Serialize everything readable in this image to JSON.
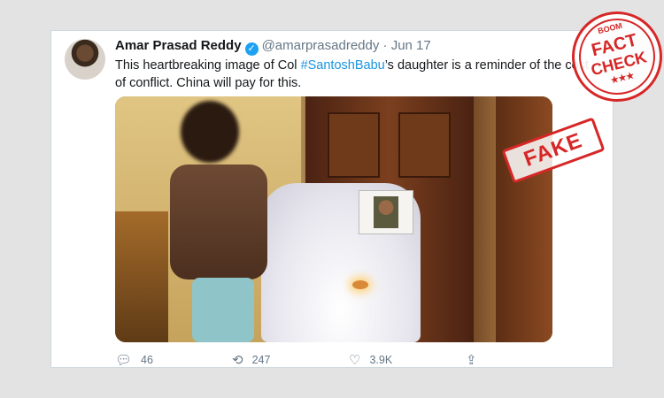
{
  "tweet": {
    "author_name": "Amar Prasad Reddy",
    "verified_glyph": "✓",
    "handle": "@amarprasadreddy",
    "separator": "·",
    "date": "Jun 17",
    "text_before": "This heartbreaking image of Col  ",
    "hashtag": "#SantoshBabu",
    "text_after": "’s daughter is a reminder of the cost of conflict. China will pay for this.",
    "actions": {
      "reply_count": "46",
      "retweet_count": "247",
      "like_count": "3.9K"
    },
    "icons": [
      "reply-icon",
      "retweet-icon",
      "like-icon",
      "share-icon",
      "chevron-down-icon"
    ]
  },
  "overlay": {
    "fake_stamp": "FAKE",
    "seal_top": "BOOM",
    "seal_line1": "FACT",
    "seal_line2": "CHECK",
    "seal_stars": "★★★"
  },
  "colors": {
    "accent": "#1da1f2",
    "hashtag": "#1b95e0",
    "stamp": "#d72626"
  }
}
